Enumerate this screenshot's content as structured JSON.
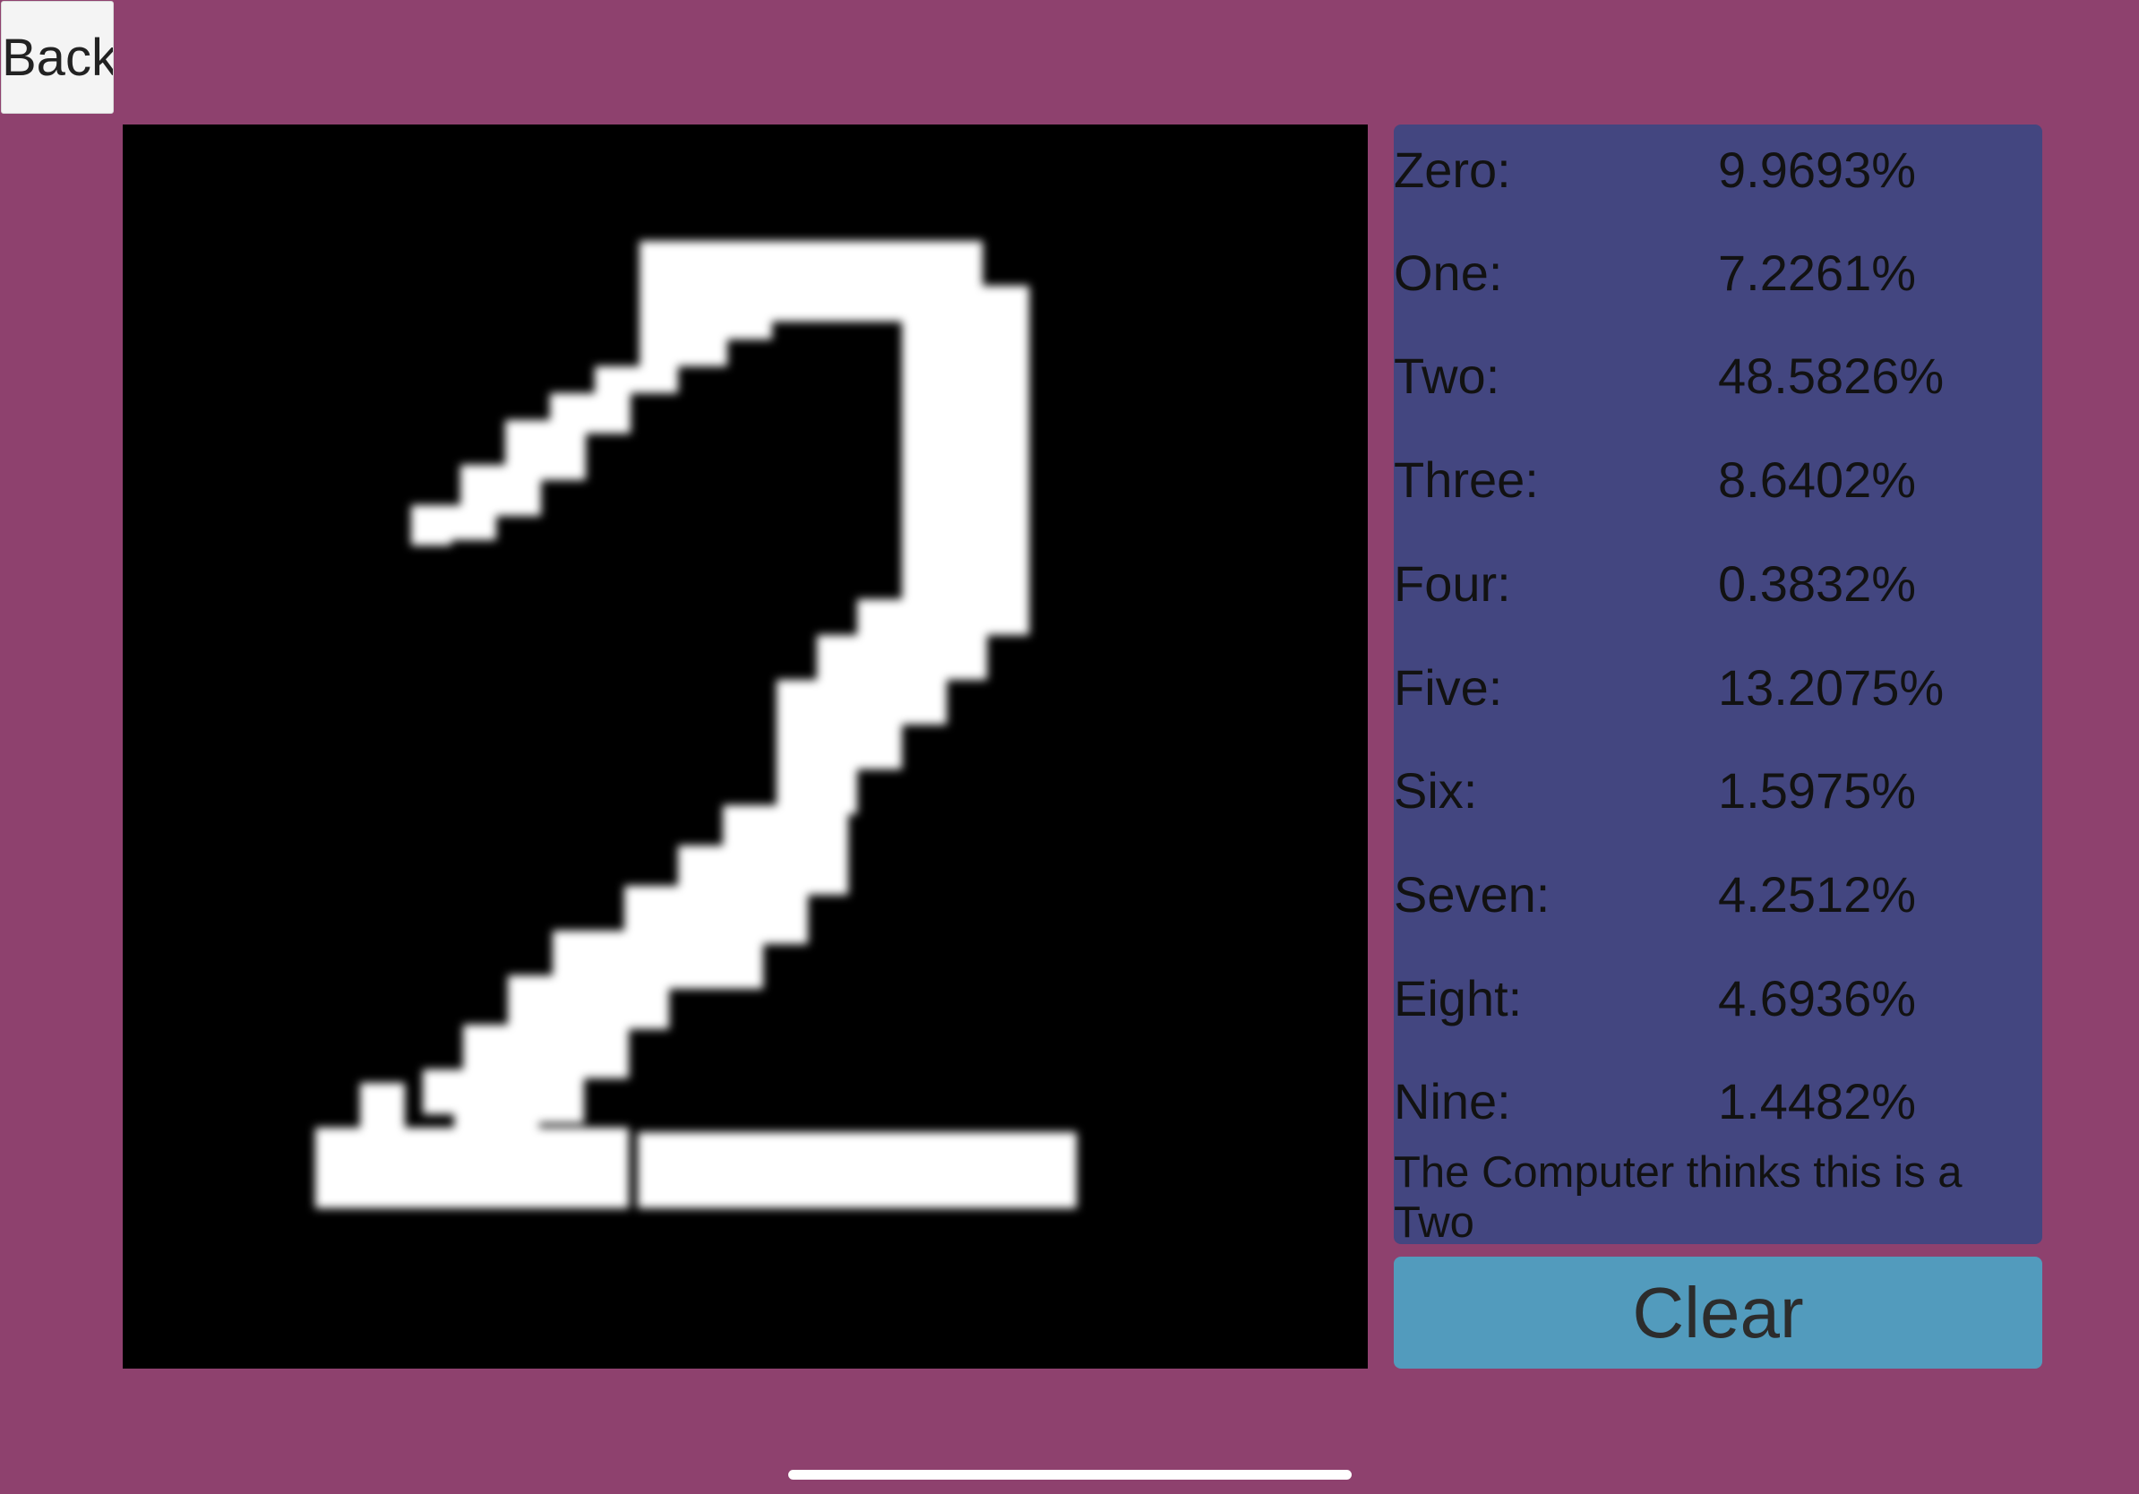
{
  "toolbar": {
    "back_label": "Back"
  },
  "canvas": {
    "drawn_digit": "two-stroke-drawing"
  },
  "predictions": [
    {
      "label": "Zero:",
      "value": "9.9693%"
    },
    {
      "label": "One:",
      "value": "7.2261%"
    },
    {
      "label": "Two:",
      "value": "48.5826%"
    },
    {
      "label": "Three:",
      "value": "8.6402%"
    },
    {
      "label": "Four:",
      "value": "0.3832%"
    },
    {
      "label": "Five:",
      "value": "13.2075%"
    },
    {
      "label": "Six:",
      "value": "1.5975%"
    },
    {
      "label": "Seven:",
      "value": "4.2512%"
    },
    {
      "label": "Eight:",
      "value": "4.6936%"
    },
    {
      "label": "Nine:",
      "value": "1.4482%"
    }
  ],
  "verdict": "The Computer thinks this is a Two",
  "clear_label": "Clear",
  "colors": {
    "background": "#8e416e",
    "panel": "#434680",
    "clear_button": "#529bbd",
    "canvas": "#000000",
    "stroke": "#ffffff"
  }
}
